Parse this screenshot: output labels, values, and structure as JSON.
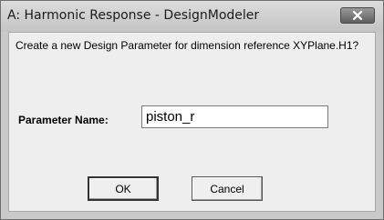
{
  "window": {
    "title": "A: Harmonic Response - DesignModeler",
    "close_icon": "close-icon"
  },
  "dialog": {
    "message": "Create a new Design Parameter for dimension reference XYPlane.H1?",
    "param_label": "Parameter Name:",
    "param_value": "piston_r",
    "ok_label": "OK",
    "cancel_label": "Cancel"
  },
  "colors": {
    "client_bg": "#eeeeee",
    "frame_bg": "#c9c9c9",
    "close_button": "#6e6e6e"
  }
}
